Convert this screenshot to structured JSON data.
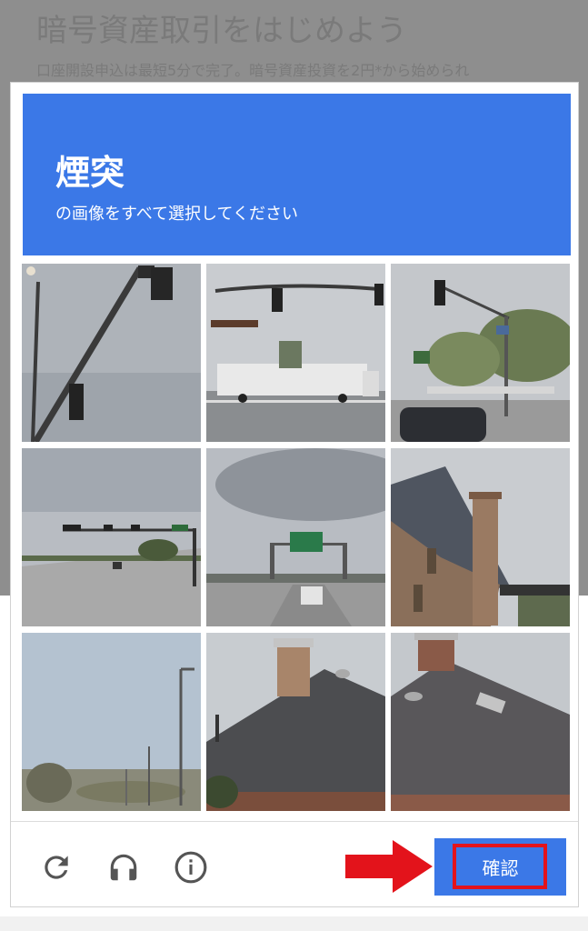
{
  "background_page": {
    "title": "暗号資産取引をはじめよう",
    "subtitle": "口座開設申込は最短5分で完了。暗号資産投資を2円*から始められ"
  },
  "captcha": {
    "target_word": "煙突",
    "instruction": "の画像をすべて選択してください",
    "tiles": [
      {
        "label": "traffic-light-sky"
      },
      {
        "label": "truck-intersection"
      },
      {
        "label": "traffic-light-trees"
      },
      {
        "label": "highway-traffic-lights"
      },
      {
        "label": "highway-green-sign"
      },
      {
        "label": "house-chimney-side"
      },
      {
        "label": "streetlight-sky"
      },
      {
        "label": "roof-chimney"
      },
      {
        "label": "roof-chimney-shingles"
      }
    ],
    "footer": {
      "reload_icon": "reload-icon",
      "audio_icon": "headphones-icon",
      "info_icon": "info-icon",
      "verify_label": "確認"
    }
  },
  "colors": {
    "header_blue": "#3b78e7",
    "highlight_red": "#e3131b",
    "overlay_gray": "#8e8e8e"
  }
}
